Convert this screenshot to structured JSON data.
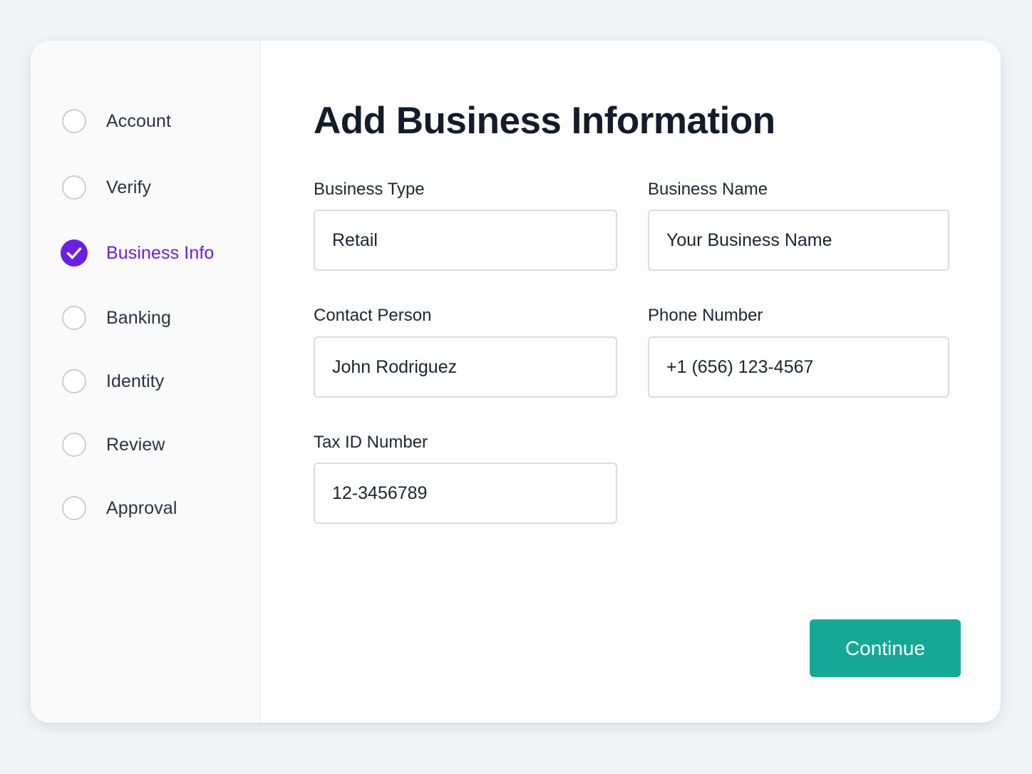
{
  "steps": [
    {
      "label": "Account",
      "state": "pending"
    },
    {
      "label": "Verify",
      "state": "pending"
    },
    {
      "label": "Business Info",
      "state": "active"
    },
    {
      "label": "Banking",
      "state": "pending"
    },
    {
      "label": "Identity",
      "state": "pending"
    },
    {
      "label": "Review",
      "state": "pending"
    },
    {
      "label": "Approval",
      "state": "pending"
    }
  ],
  "colors": {
    "accent": "#6a1fe0",
    "button": "#16a896",
    "text": "#141c2b",
    "circle_border": "#c9cdd3"
  },
  "form": {
    "title": "Add Business Information",
    "business_type": {
      "label": "Business Type",
      "value": "Retail"
    },
    "business_name": {
      "label": "Business Name",
      "placeholder": "Your Business Name"
    },
    "contact_person": {
      "label": "Contact Person",
      "value": "John Rodriguez"
    },
    "phone_number": {
      "label": "Phone Number",
      "value": "+1 (656) 123-4567"
    },
    "tax_id": {
      "label": "Tax ID Number",
      "value": "12-3456789"
    }
  },
  "actions": {
    "continue_label": "Continue"
  }
}
